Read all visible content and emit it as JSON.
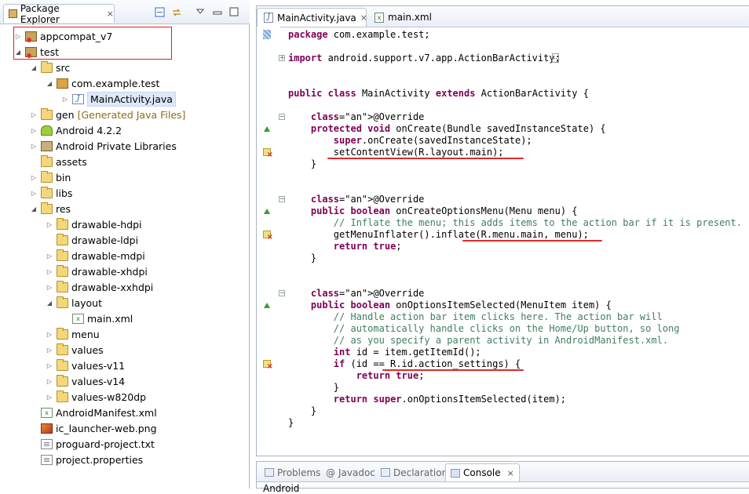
{
  "package_explorer": {
    "title": "Package Explorer",
    "close_icon": "×",
    "toolbar_icons": [
      "collapse-all-icon",
      "link-with-editor-icon",
      "view-menu-icon",
      "minimize-icon",
      "maximize-icon"
    ],
    "tree": [
      {
        "label": "appcompat_v7",
        "icon": "project-icon",
        "expander": "▷"
      },
      {
        "label": "test",
        "icon": "project-icon",
        "expander": "◢"
      },
      {
        "label": "src",
        "icon": "folder-icon",
        "expander": "◢"
      },
      {
        "label": "com.example.test",
        "icon": "package-icon",
        "expander": "◢"
      },
      {
        "label": "MainActivity.java",
        "icon": "java-file-icon",
        "expander": "▷"
      },
      {
        "label": "gen",
        "note": "[Generated Java Files]",
        "icon": "folder-icon",
        "expander": "▷"
      },
      {
        "label": "Android 4.2.2",
        "icon": "android-lib-icon",
        "expander": "▷"
      },
      {
        "label": "Android Private Libraries",
        "icon": "library-icon",
        "expander": "▷"
      },
      {
        "label": "assets",
        "icon": "folder-icon",
        "expander": ""
      },
      {
        "label": "bin",
        "icon": "folder-icon",
        "expander": "▷"
      },
      {
        "label": "libs",
        "icon": "folder-icon",
        "expander": "▷"
      },
      {
        "label": "res",
        "icon": "folder-icon",
        "expander": "◢"
      },
      {
        "label": "drawable-hdpi",
        "icon": "folder-icon",
        "expander": "▷"
      },
      {
        "label": "drawable-ldpi",
        "icon": "folder-icon",
        "expander": ""
      },
      {
        "label": "drawable-mdpi",
        "icon": "folder-icon",
        "expander": "▷"
      },
      {
        "label": "drawable-xhdpi",
        "icon": "folder-icon",
        "expander": "▷"
      },
      {
        "label": "drawable-xxhdpi",
        "icon": "folder-icon",
        "expander": "▷"
      },
      {
        "label": "layout",
        "icon": "folder-icon",
        "expander": "◢"
      },
      {
        "label": "main.xml",
        "icon": "xml-file-icon",
        "expander": ""
      },
      {
        "label": "menu",
        "icon": "folder-icon",
        "expander": "▷"
      },
      {
        "label": "values",
        "icon": "folder-icon",
        "expander": "▷"
      },
      {
        "label": "values-v11",
        "icon": "folder-icon",
        "expander": "▷"
      },
      {
        "label": "values-v14",
        "icon": "folder-icon",
        "expander": "▷"
      },
      {
        "label": "values-w820dp",
        "icon": "folder-icon",
        "expander": "▷"
      },
      {
        "label": "AndroidManifest.xml",
        "icon": "xml-file-icon",
        "expander": ""
      },
      {
        "label": "ic_launcher-web.png",
        "icon": "image-file-icon",
        "expander": ""
      },
      {
        "label": "proguard-project.txt",
        "icon": "text-file-icon",
        "expander": ""
      },
      {
        "label": "project.properties",
        "icon": "text-file-icon",
        "expander": ""
      }
    ]
  },
  "editor": {
    "tabs": [
      {
        "label": "MainActivity.java",
        "active": true,
        "close": "×"
      },
      {
        "label": "main.xml",
        "active": false
      }
    ],
    "code_lines": [
      "package com.example.test;",
      "",
      "import android.support.v7.app.ActionBarActivity;",
      "",
      "",
      "public class MainActivity extends ActionBarActivity {",
      "",
      "    @Override",
      "    protected void onCreate(Bundle savedInstanceState) {",
      "        super.onCreate(savedInstanceState);",
      "        setContentView(R.layout.main);",
      "    }",
      "",
      "",
      "    @Override",
      "    public boolean onCreateOptionsMenu(Menu menu) {",
      "        // Inflate the menu; this adds items to the action bar if it is present.",
      "        getMenuInflater().inflate(R.menu.main, menu);",
      "        return true;",
      "    }",
      "",
      "",
      "    @Override",
      "    public boolean onOptionsItemSelected(MenuItem item) {",
      "        // Handle action bar item clicks here. The action bar will",
      "        // automatically handle clicks on the Home/Up button, so long",
      "        // as you specify a parent activity in AndroidManifest.xml.",
      "        int id = item.getItemId();",
      "        if (id == R.id.action_settings) {",
      "            return true;",
      "        }",
      "        return super.onOptionsItemSelected(item);",
      "    }",
      "}"
    ]
  },
  "bottom_panel": {
    "tabs": [
      {
        "label": "Problems",
        "active": false
      },
      {
        "label": "Javadoc",
        "active": false,
        "prefix": "@"
      },
      {
        "label": "Declaration",
        "active": false
      },
      {
        "label": "Console",
        "active": true,
        "close": "×"
      }
    ],
    "console_text": "Android"
  },
  "colors": {
    "keyword": "#7f0055",
    "comment": "#3f7f5f",
    "annotation": "#646464",
    "highlight_box": "#e02020",
    "underline": "#e02a2a"
  }
}
